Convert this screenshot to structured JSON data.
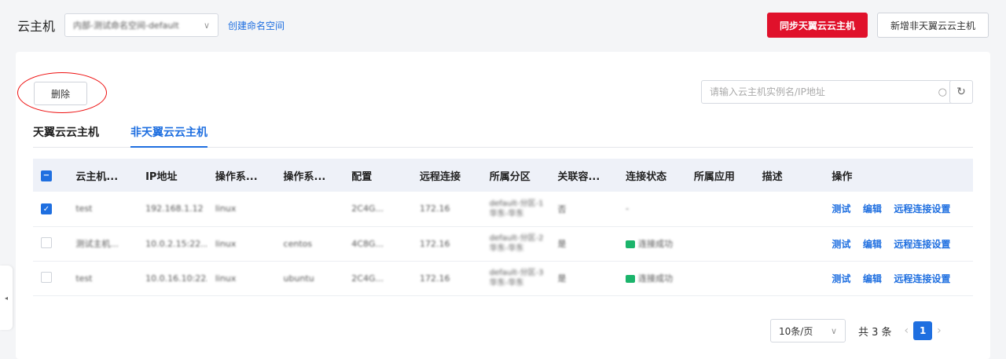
{
  "header": {
    "title": "云主机",
    "namespace_value": "内部-测试命名空间-default",
    "create_namespace_link": "创建命名空间",
    "sync_button": "同步天翼云云主机",
    "add_button": "新增非天翼云云主机"
  },
  "toolbar": {
    "delete_button": "删除",
    "search_placeholder": "请输入云主机实例名/IP地址"
  },
  "tabs": [
    {
      "label": "天翼云云主机",
      "active": false
    },
    {
      "label": "非天翼云云主机",
      "active": true
    }
  ],
  "table": {
    "columns": [
      "云主机...",
      "IP地址",
      "操作系...",
      "操作系...",
      "配置",
      "远程连接",
      "所属分区",
      "关联容...",
      "连接状态",
      "所属应用",
      "描述",
      "操作"
    ],
    "rows": [
      {
        "checked": true,
        "name": "test",
        "ip": "192.168.1.12",
        "os": "linux",
        "os_ver": "",
        "config": "2C4G...",
        "remote_host": "172.16",
        "remote_tag": "",
        "partition": "default-分区-1 华东-华东",
        "related": "否",
        "status": "-",
        "app": "",
        "desc": ""
      },
      {
        "checked": false,
        "name": "测试主机...",
        "ip": "10.0.2.15:22...",
        "os": "linux",
        "os_ver": "centos",
        "config": "4C8G...",
        "remote_host": "172.16",
        "remote_tag": "",
        "partition": "default-分区-2 华东-华东",
        "related": "是",
        "status": "连接成功",
        "app": "",
        "desc": ""
      },
      {
        "checked": false,
        "name": "test",
        "ip": "10.0.16.10:22...",
        "os": "linux",
        "os_ver": "ubuntu",
        "config": "2C4G...",
        "remote_host": "172.16",
        "remote_tag": "",
        "partition": "default-分区-3 华东-华东",
        "related": "是",
        "status": "连接成功",
        "app": "",
        "desc": ""
      }
    ],
    "actions": [
      "测试",
      "编辑",
      "远程连接设置"
    ]
  },
  "pagination": {
    "page_size": "10条/页",
    "total": "共 3 条",
    "current_page": "1"
  },
  "colors": {
    "primary_blue": "#1f6fe0",
    "brand_red": "#e0112b",
    "status_green": "#1bb46b"
  }
}
